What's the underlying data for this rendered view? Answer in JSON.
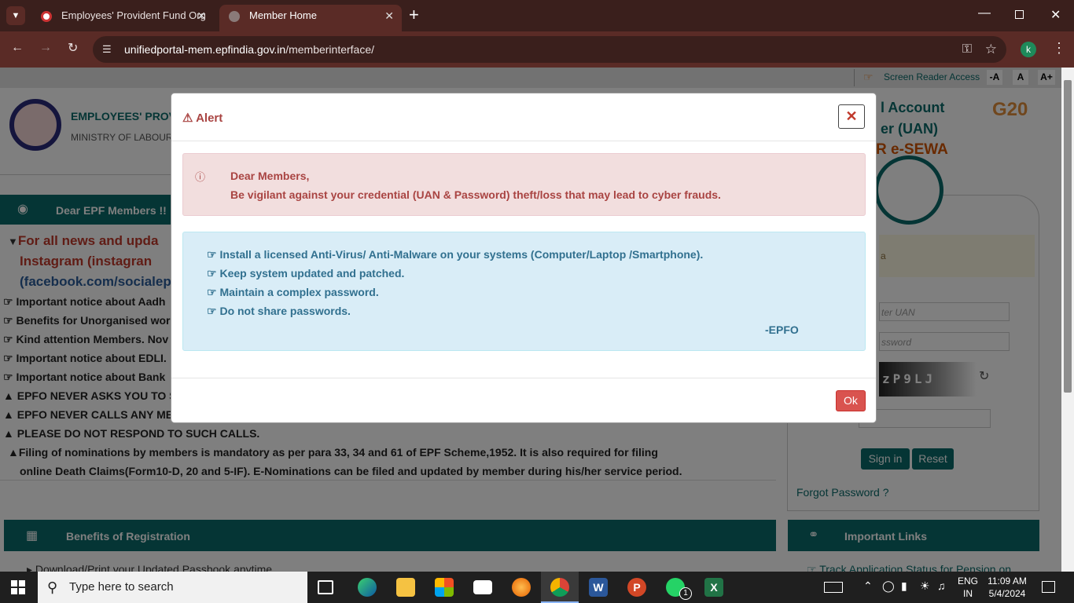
{
  "browser": {
    "tabs": [
      {
        "title": "Employees' Provident Fund Org"
      },
      {
        "title": "Member Home"
      }
    ],
    "url_host": "unifiedportal-mem.epfindia.gov.in",
    "url_path": "/memberinterface/",
    "profile_initial": "k"
  },
  "accessibility": {
    "screen_reader": "Screen Reader Access",
    "font_small": "-A",
    "font_normal": "A",
    "font_large": "A+"
  },
  "header": {
    "org_name": "EMPLOYEES' PROVI",
    "ministry": "MINISTRY OF LABOUR &",
    "right_title_1": "l Account",
    "right_title_2": "er (UAN)",
    "right_title_3": "R e-SEWA",
    "g20": "G20"
  },
  "news": {
    "heading": "Dear EPF Members !!",
    "intro_1": "For all news and upda",
    "intro_2": "Instagram (instagran",
    "intro_3": "(facebook.com/socialep",
    "items": [
      "Important notice about Aadh",
      "Benefits for Unorganised wor",
      "Kind attention Members. Nov",
      "Important notice about EDLI.",
      "Important notice about Bank",
      "EPFO NEVER ASKS YOU TO SH",
      "EPFO NEVER CALLS ANY MEM",
      "PLEASE DO NOT RESPOND TO SUCH CALLS."
    ],
    "nomination_1": "Filing of nominations by members is mandatory as per para 33, 34 and 61 of EPF Scheme,1952. It is also required for filing",
    "nomination_2": "online Death Claims(Form10-D, 20 and 5-IF). E-Nominations can be filed and updated by member during his/her service period."
  },
  "benefits": {
    "heading": "Benefits of Registration",
    "first_item": "Download/Print your Updated Passbook anytime."
  },
  "login": {
    "notice_fragment": "a",
    "uan_placeholder": "ter UAN",
    "password_placeholder": "ssword",
    "captcha_text": "zP9LJ",
    "signin_label": "Sign in",
    "reset_label": "Reset",
    "forgot_label": "Forgot Password ?"
  },
  "links": {
    "heading": "Important Links",
    "first_item": "Track Application Status for Pension on"
  },
  "modal": {
    "title": "Alert",
    "close_symbol": "✕",
    "danger_line_1": "Dear Members,",
    "danger_line_2": "Be vigilant against your credential (UAN & Password) theft/loss that may lead to cyber frauds.",
    "tips": [
      "Install a licensed Anti-Virus/ Anti-Malware on your systems (Computer/Laptop /Smartphone).",
      "Keep system updated and patched.",
      "Maintain a complex password.",
      "Do not share passwords."
    ],
    "signature": "-EPFO",
    "ok_label": "Ok"
  },
  "taskbar": {
    "search_placeholder": "Type here to search",
    "lang_1": "ENG",
    "lang_2": "IN",
    "time": "11:09 AM",
    "date": "5/4/2024",
    "whatsapp_badge": "1"
  },
  "colors": {
    "teal": "#0a6b6a",
    "danger_text": "#a94442",
    "info_text": "#31708f",
    "ok_button": "#d9534f"
  }
}
